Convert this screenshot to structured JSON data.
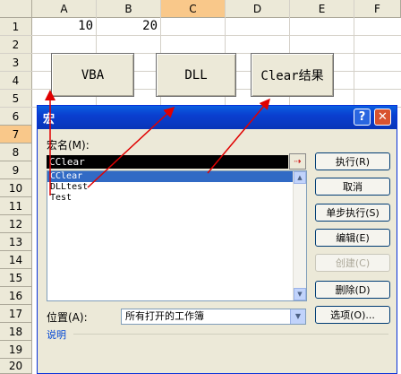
{
  "sheet": {
    "columns": [
      "A",
      "B",
      "C",
      "D",
      "E",
      "F"
    ],
    "active_column": "C",
    "rows": [
      "1",
      "2",
      "3",
      "4",
      "5",
      "6",
      "7",
      "8",
      "9",
      "10",
      "11",
      "12",
      "13",
      "14",
      "15",
      "16",
      "17",
      "18",
      "19",
      "20"
    ],
    "active_row": "7",
    "cells": {
      "A1": "10",
      "B1": "20"
    },
    "buttons": {
      "vba": "VBA",
      "dll": "DLL",
      "clear": "Clear结果"
    }
  },
  "dialog": {
    "title": "宏",
    "help_icon": "?",
    "close_icon": "✕",
    "macro_name_label": "宏名(M):",
    "macro_name_value": "CClear",
    "ref_icon": "⇢",
    "macros": [
      "CClear",
      "DLLtest",
      "Test"
    ],
    "selected_macro": "CClear",
    "buttons": {
      "run": "执行(R)",
      "cancel": "取消",
      "step": "单步执行(S)",
      "edit": "编辑(E)",
      "create": "创建(C)",
      "delete": "删除(D)",
      "options": "选项(O)..."
    },
    "location_label": "位置(A):",
    "location_value": "所有打开的工作簿",
    "description_label": "说明"
  },
  "colors": {
    "title_bar": "#0a5fe0",
    "selection": "#316ac5",
    "annotation_arrow": "#e00000"
  }
}
